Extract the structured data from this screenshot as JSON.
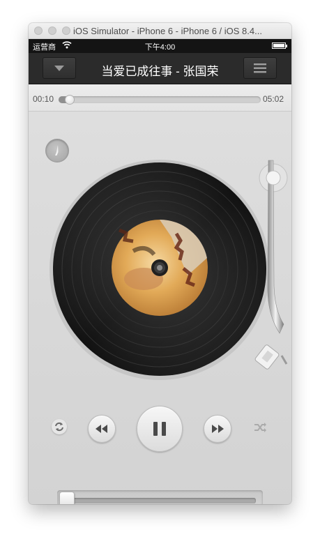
{
  "window": {
    "title": "iOS Simulator - iPhone 6 - iPhone 6 / iOS 8.4..."
  },
  "status_bar": {
    "carrier": "运营商",
    "time": "下午4:00"
  },
  "nav": {
    "title": "当爱已成往事 - 张国荣",
    "left_icon": "chevron-down-icon",
    "right_icon": "menu-icon"
  },
  "progress": {
    "elapsed": "00:10",
    "total": "05:02",
    "fraction": 0.033
  },
  "player": {
    "state": "playing",
    "volume_fraction": 0.0
  },
  "colors": {
    "nav_bg": "#2b2b2b",
    "status_bg": "#141414",
    "deck_bg": "#d8d8d8",
    "record": "#1a1a1a"
  }
}
